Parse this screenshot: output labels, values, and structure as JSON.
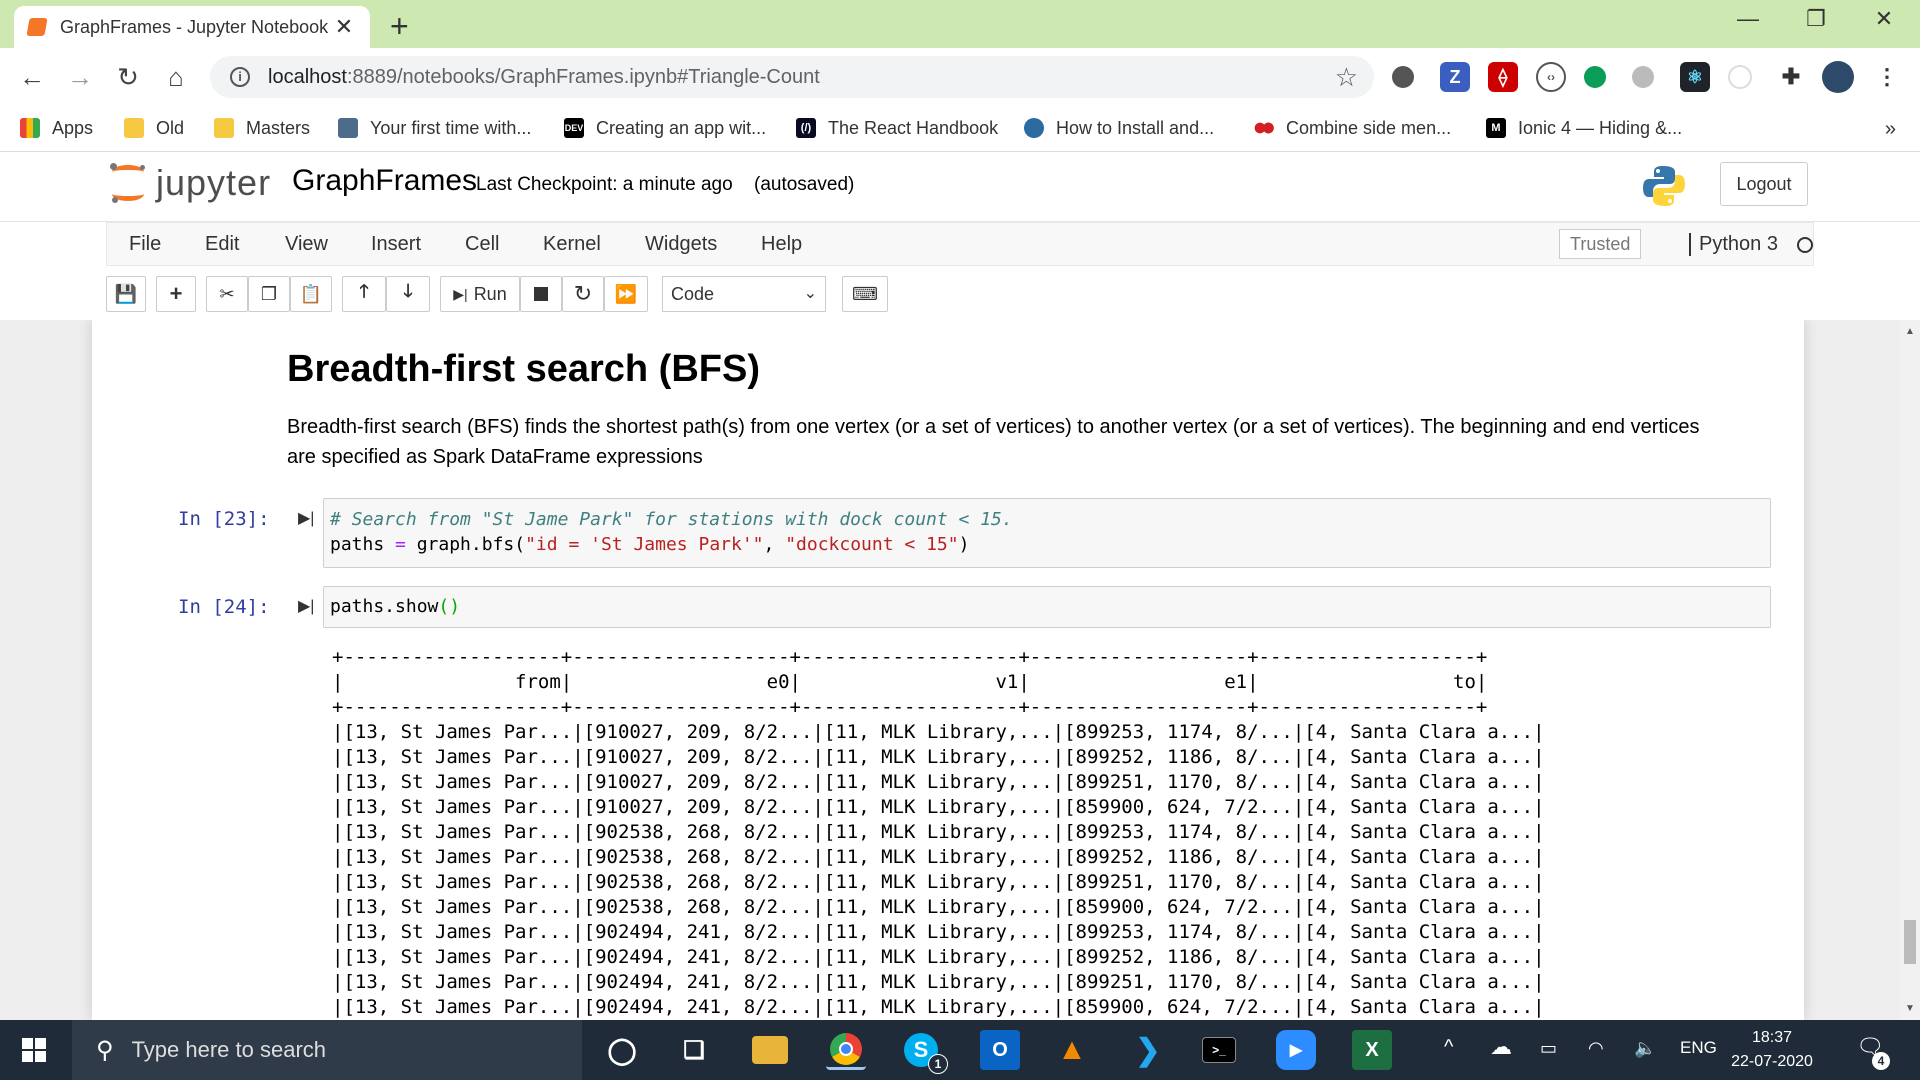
{
  "browser": {
    "tab_title": "GraphFrames - Jupyter Notebook",
    "tab_close": "✕",
    "new_tab": "+",
    "window_controls": {
      "minimize": "—",
      "restore": "❐",
      "close": "✕"
    },
    "nav": {
      "back": "←",
      "forward": "→",
      "reload": "↻",
      "home": "⌂"
    },
    "url_host": "localhost",
    "url_rest": ":8889/notebooks/GraphFrames.ipynb#Triangle-Count",
    "star": "☆",
    "bookmarks": [
      {
        "label": "Apps",
        "icon": "apps-grid-icon",
        "color": "#4285f4"
      },
      {
        "label": "Old",
        "icon": "folder-icon",
        "color": "#f6c843"
      },
      {
        "label": "Masters",
        "icon": "folder-icon",
        "color": "#f6c843"
      },
      {
        "label": "Your first time with...",
        "icon": "page-icon",
        "color": "#4d6b8a"
      },
      {
        "label": "Creating an app wit...",
        "icon": "dev-icon",
        "color": "#000000"
      },
      {
        "label": "The React Handbook",
        "icon": "freecodecamp-icon",
        "color": "#0a0a23"
      },
      {
        "label": "How to Install and...",
        "icon": "globe-icon",
        "color": "#2c6aa0"
      },
      {
        "label": "Combine side men...",
        "icon": "red-dots-icon",
        "color": "#d31f1f"
      },
      {
        "label": "Ionic 4 — Hiding &...",
        "icon": "medium-icon",
        "color": "#000000"
      }
    ],
    "bookmarks_more": "»"
  },
  "jupyter": {
    "logo_text": "jupyter",
    "notebook_name": "GraphFrames",
    "checkpoint": "Last Checkpoint: a minute ago",
    "autosaved": "(autosaved)",
    "logout": "Logout",
    "menu": [
      "File",
      "Edit",
      "View",
      "Insert",
      "Cell",
      "Kernel",
      "Widgets",
      "Help"
    ],
    "trusted": "Trusted",
    "kernel": "Python 3",
    "toolbar": {
      "run_label": "Run",
      "cell_type": "Code"
    }
  },
  "notebook": {
    "heading": "Breadth-first search (BFS)",
    "paragraph": "Breadth-first search (BFS) finds the shortest path(s) from one vertex (or a set of vertices) to another vertex (or a set of vertices). The beginning and end vertices are specified as Spark DataFrame expressions",
    "cell1": {
      "prompt": "In [23]:",
      "comment": "# Search from \"St Jame Park\" for stations with dock count < 15.",
      "code_a": "paths ",
      "code_eq": "=",
      "code_b": " graph.bfs(",
      "code_s1": "\"id = 'St James Park'\"",
      "code_c": ", ",
      "code_s2": "\"dockcount < 15\"",
      "code_d": ")"
    },
    "cell2": {
      "prompt": "In [24]:",
      "code_a": "paths.show",
      "code_paren": "()"
    },
    "output_lines": [
      "+-------------------+-------------------+-------------------+-------------------+-------------------+",
      "|               from|                 e0|                 v1|                 e1|                 to|",
      "+-------------------+-------------------+-------------------+-------------------+-------------------+",
      "|[13, St James Par...|[910027, 209, 8/2...|[11, MLK Library,...|[899253, 1174, 8/...|[4, Santa Clara a...|",
      "|[13, St James Par...|[910027, 209, 8/2...|[11, MLK Library,...|[899252, 1186, 8/...|[4, Santa Clara a...|",
      "|[13, St James Par...|[910027, 209, 8/2...|[11, MLK Library,...|[899251, 1170, 8/...|[4, Santa Clara a...|",
      "|[13, St James Par...|[910027, 209, 8/2...|[11, MLK Library,...|[859900, 624, 7/2...|[4, Santa Clara a...|",
      "|[13, St James Par...|[902538, 268, 8/2...|[11, MLK Library,...|[899253, 1174, 8/...|[4, Santa Clara a...|",
      "|[13, St James Par...|[902538, 268, 8/2...|[11, MLK Library,...|[899252, 1186, 8/...|[4, Santa Clara a...|",
      "|[13, St James Par...|[902538, 268, 8/2...|[11, MLK Library,...|[899251, 1170, 8/...|[4, Santa Clara a...|",
      "|[13, St James Par...|[902538, 268, 8/2...|[11, MLK Library,...|[859900, 624, 7/2...|[4, Santa Clara a...|",
      "|[13, St James Par...|[902494, 241, 8/2...|[11, MLK Library,...|[899253, 1174, 8/...|[4, Santa Clara a...|",
      "|[13, St James Par...|[902494, 241, 8/2...|[11, MLK Library,...|[899252, 1186, 8/...|[4, Santa Clara a...|",
      "|[13, St James Par...|[902494, 241, 8/2...|[11, MLK Library,...|[899251, 1170, 8/...|[4, Santa Clara a...|",
      "|[13, St James Par...|[902494, 241, 8/2...|[11, MLK Library,...|[859900, 624, 7/2...|[4, Santa Clara a...|"
    ]
  },
  "taskbar": {
    "search_placeholder": "Type here to search",
    "language": "ENG",
    "time": "18:37",
    "date": "22-07-2020",
    "notification_count": "4",
    "skype_badge": "1",
    "tray_chevron": "^",
    "apps": [
      "cortana-icon",
      "task-view-icon",
      "file-explorer-icon",
      "chrome-icon",
      "skype-icon",
      "outlook-icon",
      "vlc-icon",
      "vscode-icon",
      "terminal-icon",
      "zoom-icon",
      "excel-icon"
    ]
  },
  "colors": {
    "tab_strip": "#cde8b0",
    "jupyter_orange": "#f37726",
    "prompt_blue": "#303f9f",
    "taskbar": "#1f2b38"
  }
}
